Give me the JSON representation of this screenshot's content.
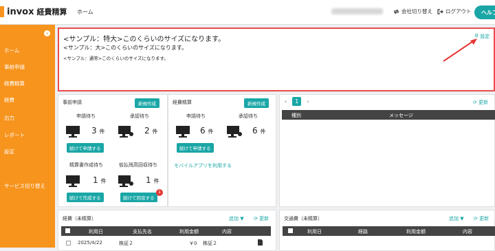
{
  "header": {
    "logo_text": "invox",
    "logo_sub": "経費精算",
    "home": "ホーム",
    "switch_company": "会社切り替え",
    "logout": "ログアウト",
    "help": "ヘルプ"
  },
  "sidebar": {
    "items": [
      {
        "label": "ホーム"
      },
      {
        "label": "事前申請"
      },
      {
        "label": "経費精算"
      },
      {
        "label": "経費"
      },
      {
        "label": "出力"
      },
      {
        "label": "レポート"
      },
      {
        "label": "設定"
      },
      {
        "label": "サービス切り替え"
      }
    ]
  },
  "notice": {
    "line1": "<サンプル：特大>このくらいのサイズになります。",
    "line2": "<サンプル：大>このくらいのサイズになります。",
    "line3": "<サンプル：通常>このくらいのサイズになります。",
    "settings": "設定"
  },
  "pre_application": {
    "title": "事前申請",
    "new": "新規作成",
    "apply_wait": "申請待ち",
    "apply_count": "3",
    "approve_wait": "承認待ち",
    "approve_count": "2",
    "continue_apply": "続けて申請する",
    "report_wait": "精算書作成待ち",
    "report_count": "1",
    "advance_wait": "仮払残高回収待ち",
    "advance_count": "1",
    "continue_create": "続けて作成する",
    "continue_collect": "続けて回収する",
    "badge": "1",
    "unit": "件"
  },
  "expense_report": {
    "title": "経費精算",
    "new": "新規作成",
    "apply_wait": "申請待ち",
    "apply_count": "6",
    "approve_wait": "承認待ち",
    "approve_count": "6",
    "continue_apply": "続けて申請する",
    "mobile": "モバイルアプリを利用する",
    "unit": "件"
  },
  "messages": {
    "page": "1",
    "refresh": "更新",
    "col_type": "種別",
    "col_message": "メッセージ"
  },
  "expenses": {
    "title": "経費（未精算）",
    "add": "追加",
    "refresh": "更新",
    "cols": [
      "利用日",
      "支払先名",
      "利用金額",
      "内容"
    ],
    "rows": [
      {
        "date": "2025/4/22",
        "payee": "株証２",
        "amount": "￥0",
        "content": "株証２"
      }
    ]
  },
  "transport": {
    "title": "交通費（未精算）",
    "add": "追加",
    "refresh": "更新",
    "cols": [
      "利用日",
      "経路",
      "利用金額",
      "内容"
    ]
  }
}
